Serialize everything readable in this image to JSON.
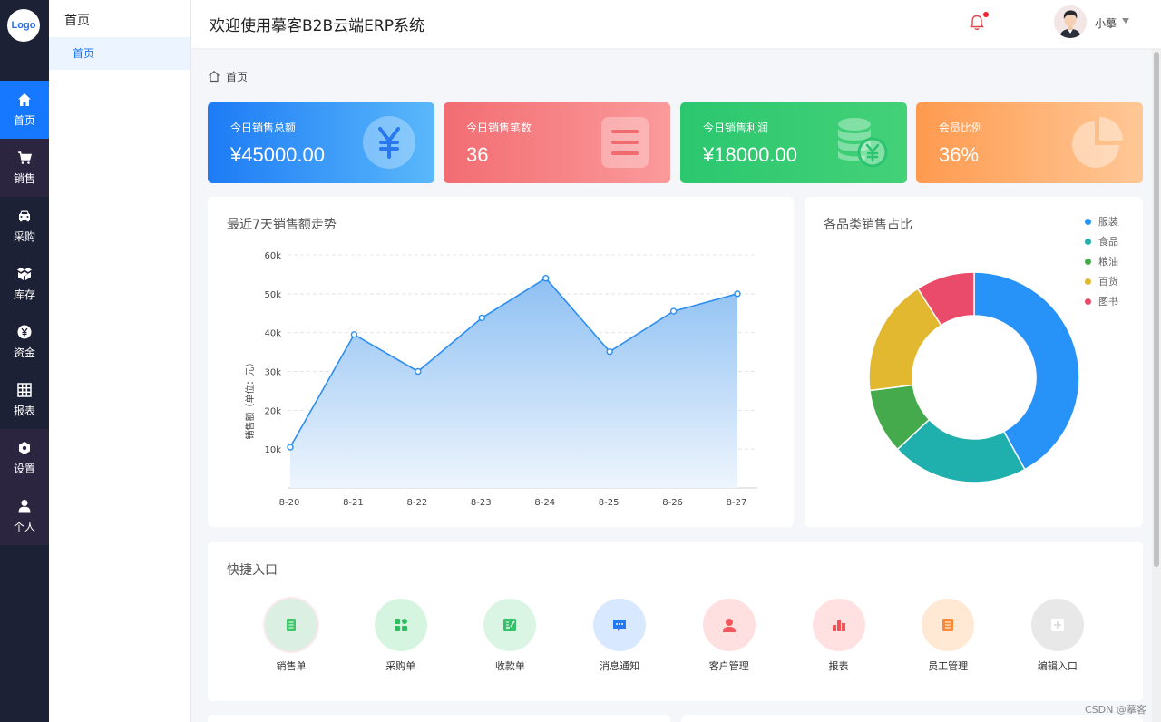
{
  "logo": "Logo",
  "rail": [
    {
      "label": "首页",
      "icon": "home-icon"
    },
    {
      "label": "销售",
      "icon": "cart-icon"
    },
    {
      "label": "采购",
      "icon": "truck-icon"
    },
    {
      "label": "库存",
      "icon": "boxes-icon"
    },
    {
      "label": "资金",
      "icon": "yen-coin-icon"
    },
    {
      "label": "报表",
      "icon": "grid-icon"
    },
    {
      "label": "设置",
      "icon": "hexagon-gear-icon"
    },
    {
      "label": "个人",
      "icon": "user-icon"
    }
  ],
  "subside": {
    "title": "首页",
    "items": [
      "首页"
    ]
  },
  "header": {
    "title": "欢迎使用摹客B2B云端ERP系统",
    "username": "小摹"
  },
  "breadcrumb": "首页",
  "stats": [
    {
      "label": "今日销售总额",
      "value": "¥45000.00",
      "icon": "yen-icon",
      "color_from": "#1d7bf6",
      "color_to": "#5ab8fb"
    },
    {
      "label": "今日销售笔数",
      "value": "36",
      "icon": "list-icon",
      "color_from": "#f26d72",
      "color_to": "#fb9a9b"
    },
    {
      "label": "今日销售利润",
      "value": "¥18000.00",
      "icon": "coins-icon",
      "color_from": "#2bc76f",
      "color_to": "#44d178"
    },
    {
      "label": "会员比例",
      "value": "36%",
      "icon": "pie-icon",
      "color_from": "#ff9a4f",
      "color_to": "#ffc897"
    }
  ],
  "line_panel": {
    "title": "最近7天销售额走势"
  },
  "pie_panel": {
    "title": "各品类销售占比"
  },
  "chart_data": [
    {
      "type": "area",
      "title": "最近7天销售额走势",
      "xlabel": "",
      "ylabel": "销售额（单位：元）",
      "categories": [
        "8-20",
        "8-21",
        "8-22",
        "8-23",
        "8-24",
        "8-25",
        "8-26",
        "8-27"
      ],
      "y_ticks": [
        "10k",
        "20k",
        "30k",
        "40k",
        "50k",
        "60k"
      ],
      "ylim": [
        0,
        60000
      ],
      "grid": true,
      "values": [
        10500,
        39500,
        30000,
        43800,
        54000,
        35100,
        45500,
        50000
      ],
      "color": "#2d8ef0"
    },
    {
      "type": "pie",
      "title": "各品类销售占比",
      "legend_position": "top-right",
      "labels": [
        "服装",
        "食品",
        "粮油",
        "百货",
        "图书"
      ],
      "values": [
        42,
        21,
        10,
        18,
        9
      ],
      "colors": [
        "#2792f7",
        "#1fb0ae",
        "#44aa4c",
        "#e1b82f",
        "#ea4b6a"
      ]
    }
  ],
  "quick_panel": {
    "title": "快捷入口"
  },
  "quick": [
    {
      "label": "销售单",
      "icon": "document-icon",
      "bg": "#dcefe3",
      "fg": "#3cc76a"
    },
    {
      "label": "采购单",
      "icon": "apps-icon",
      "bg": "#d6f5e1",
      "fg": "#2fbf62"
    },
    {
      "label": "收款单",
      "icon": "edit-note-icon",
      "bg": "#dbf5e4",
      "fg": "#33c26a"
    },
    {
      "label": "消息通知",
      "icon": "chat-icon",
      "bg": "#d7e8ff",
      "fg": "#2479f2"
    },
    {
      "label": "客户管理",
      "icon": "person-icon",
      "bg": "#ffe0e0",
      "fg": "#f0585c"
    },
    {
      "label": "报表",
      "icon": "bar-chart-icon",
      "bg": "#ffe1e1",
      "fg": "#f25358"
    },
    {
      "label": "员工管理",
      "icon": "file-icon",
      "bg": "#ffe8d4",
      "fg": "#fa8a37"
    },
    {
      "label": "编辑入口",
      "icon": "plus-icon",
      "bg": "#e8e8e8",
      "fg": "#ffffff"
    }
  ],
  "watermark": "CSDN @摹客"
}
